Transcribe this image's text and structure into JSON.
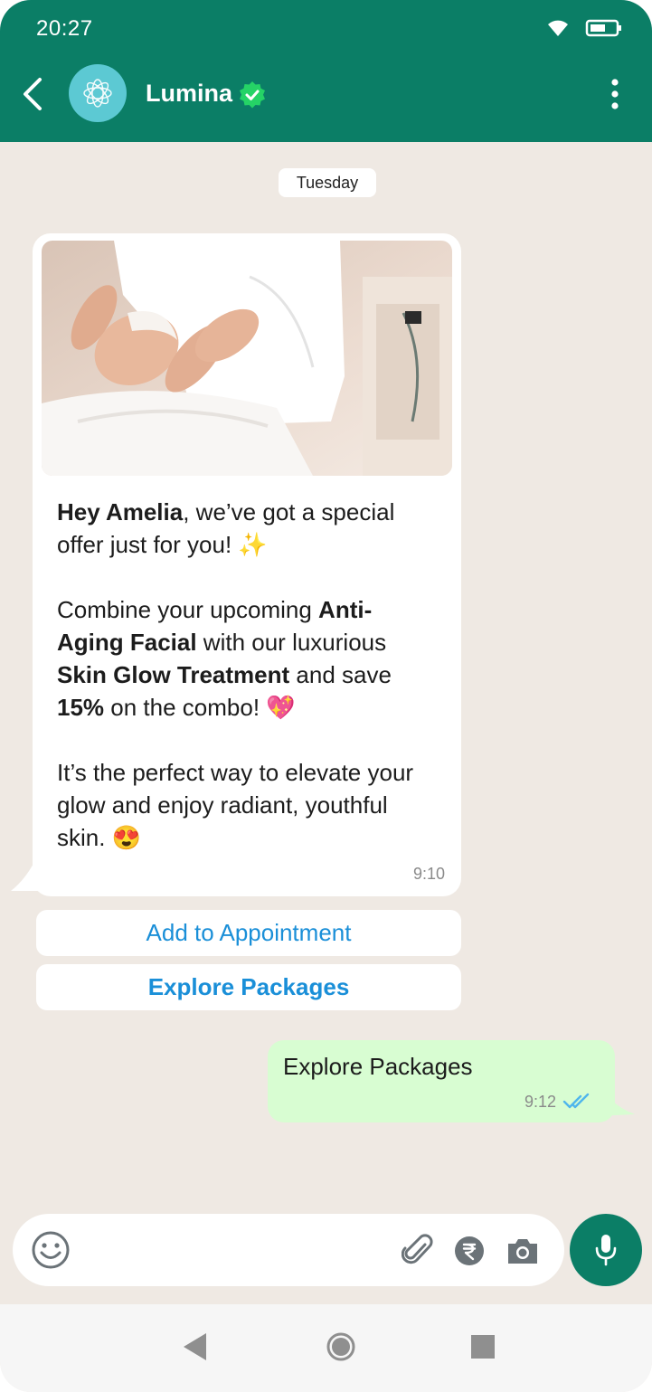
{
  "status_bar": {
    "time": "20:27"
  },
  "header": {
    "contact_name": "Lumina"
  },
  "chat": {
    "day_label": "Tuesday",
    "incoming": {
      "greeting_name": "Hey Amelia",
      "line1_rest": ", we’ve got a special offer just for you! ✨",
      "p2_a": "Combine your upcoming ",
      "p2_b": "Anti-Aging Facial",
      "p2_c": " with our luxurious ",
      "p2_d": "Skin Glow Treatment",
      "p2_e": " and save ",
      "p2_f": "15%",
      "p2_g": " on the combo! 💖",
      "p3": "It’s the perfect way to elevate your glow and enjoy radiant, youthful skin. 😍",
      "time": "9:10"
    },
    "quick_replies": [
      "Add to Appointment",
      "Explore Packages"
    ],
    "outgoing": {
      "text": "Explore Packages",
      "time": "9:12"
    }
  },
  "composer": {
    "placeholder": ""
  },
  "colors": {
    "header_green": "#0b7e66",
    "link_blue": "#1a8fd8",
    "outgoing_bubble": "#d8fdd2",
    "chat_background": "#efe9e3",
    "read_tick_blue": "#4fb6ec",
    "verified_green": "#25d366"
  },
  "icons": [
    "back-arrow-icon",
    "lotus-logo-icon",
    "verified-badge-icon",
    "more-vert-icon",
    "wifi-icon",
    "battery-icon",
    "emoji-icon",
    "attach-icon",
    "rupee-icon",
    "camera-icon",
    "mic-icon",
    "double-tick-icon",
    "nav-back-icon",
    "nav-home-icon",
    "nav-recents-icon"
  ]
}
